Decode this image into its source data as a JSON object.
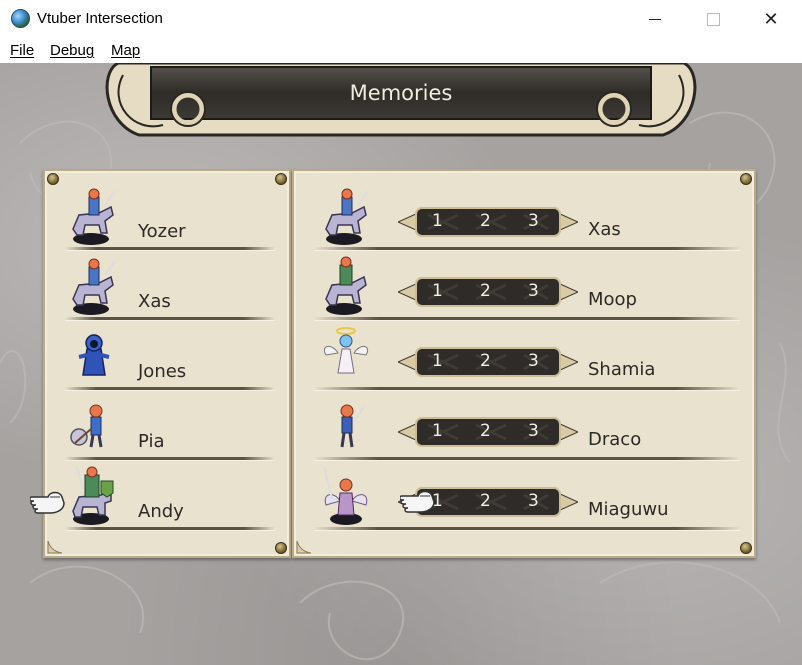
{
  "window": {
    "title": "Vtuber Intersection",
    "min_glyph": "",
    "close_glyph": "✕"
  },
  "menu": [
    "File",
    "Debug",
    "Map"
  ],
  "screen": {
    "title": "Memories",
    "left_list": [
      {
        "name": "Yozer",
        "sprite": "cavalier-icon"
      },
      {
        "name": "Xas",
        "sprite": "cavalier-icon"
      },
      {
        "name": "Jones",
        "sprite": "mage-icon"
      },
      {
        "name": "Pia",
        "sprite": "axe-fighter-icon"
      },
      {
        "name": "Andy",
        "sprite": "armored-knight-icon"
      }
    ],
    "right_list": [
      {
        "name": "Xas",
        "sprite": "cavalier-icon",
        "levels": [
          "1",
          "2",
          "3"
        ]
      },
      {
        "name": "Moop",
        "sprite": "cavalier-icon",
        "levels": [
          "1",
          "2",
          "3"
        ]
      },
      {
        "name": "Shamia",
        "sprite": "angel-icon",
        "levels": [
          "1",
          "2",
          "3"
        ]
      },
      {
        "name": "Draco",
        "sprite": "swordsman-icon",
        "levels": [
          "1",
          "2",
          "3"
        ]
      },
      {
        "name": "Miaguwu",
        "sprite": "pegasus-knight-icon",
        "levels": [
          "1",
          "2",
          "3"
        ]
      }
    ],
    "cursor": {
      "left_row": 5,
      "right_row": 5
    }
  },
  "colors": {
    "panel": "#e9e2cf",
    "banner": "#3a3733",
    "text": "#2c2a26"
  }
}
